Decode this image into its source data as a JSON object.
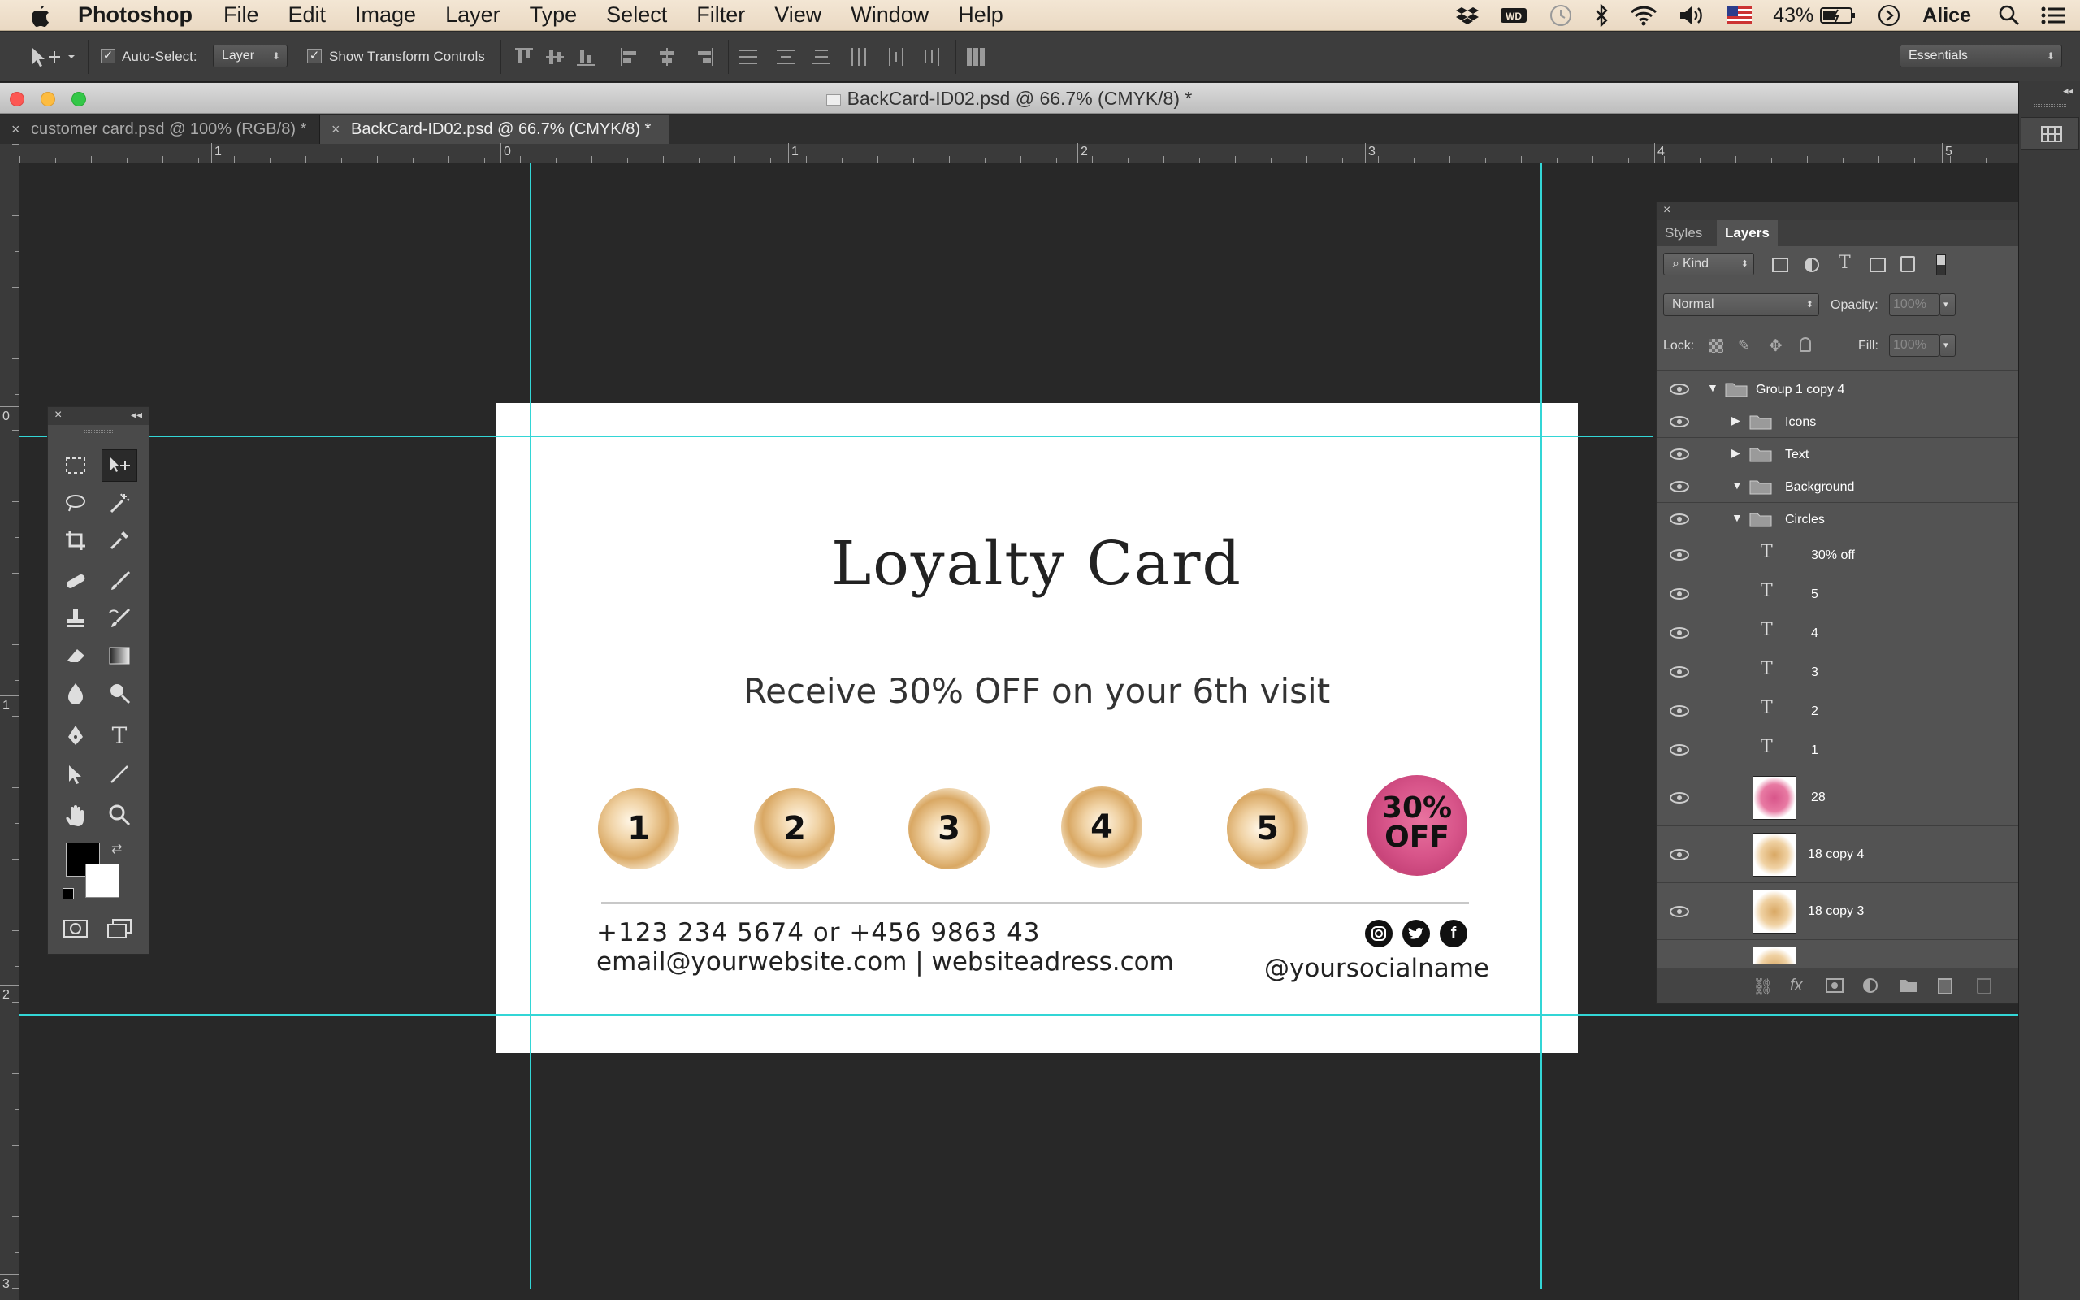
{
  "menubar": {
    "app": "Photoshop",
    "items": [
      "File",
      "Edit",
      "Image",
      "Layer",
      "Type",
      "Select",
      "Filter",
      "View",
      "Window",
      "Help"
    ],
    "battery": "43%",
    "user": "Alice"
  },
  "options": {
    "auto_select_label": "Auto-Select:",
    "auto_select_target": "Layer",
    "show_transform_label": "Show Transform Controls",
    "workspace": "Essentials"
  },
  "document": {
    "title": "BackCard-ID02.psd @ 66.7% (CMYK/8) *",
    "tabs": [
      {
        "label": "customer card.psd @ 100% (RGB/8) *"
      },
      {
        "label": "BackCard-ID02.psd @ 66.7% (CMYK/8) *"
      }
    ]
  },
  "rulers": {
    "h_labels": [
      "1",
      "0",
      "1",
      "2",
      "3",
      "4",
      "5"
    ],
    "v_labels": [
      "0",
      "1",
      "2",
      "3"
    ]
  },
  "card": {
    "title": "Loyalty Card",
    "subtitle": "Receive 30% OFF on your 6th visit",
    "stamps": [
      "1",
      "2",
      "3",
      "4",
      "5"
    ],
    "reward_line1": "30%",
    "reward_line2": "OFF",
    "phone": "+123 234 5674 or +456 9863 43",
    "web": "email@yourwebsite.com | websiteadress.com",
    "social": "@yoursocialname"
  },
  "layers_panel": {
    "tabs": [
      "Styles",
      "Layers"
    ],
    "filter_kind": "Kind",
    "blend_mode": "Normal",
    "opacity_label": "Opacity:",
    "opacity_value": "100%",
    "lock_label": "Lock:",
    "fill_label": "Fill:",
    "fill_value": "100%",
    "layers": [
      {
        "name": "Group 1 copy 4"
      },
      {
        "name": "Icons"
      },
      {
        "name": "Text"
      },
      {
        "name": "Background"
      },
      {
        "name": "Circles"
      },
      {
        "name": "30% off"
      },
      {
        "name": "5"
      },
      {
        "name": "4"
      },
      {
        "name": "3"
      },
      {
        "name": "2"
      },
      {
        "name": "1"
      },
      {
        "name": "28"
      },
      {
        "name": "18 copy 4"
      },
      {
        "name": "18 copy 3"
      }
    ]
  },
  "colors": {
    "guide": "#33d6d6",
    "stamp_gold": "#d9b07a",
    "reward_pink": "#d8558a"
  }
}
